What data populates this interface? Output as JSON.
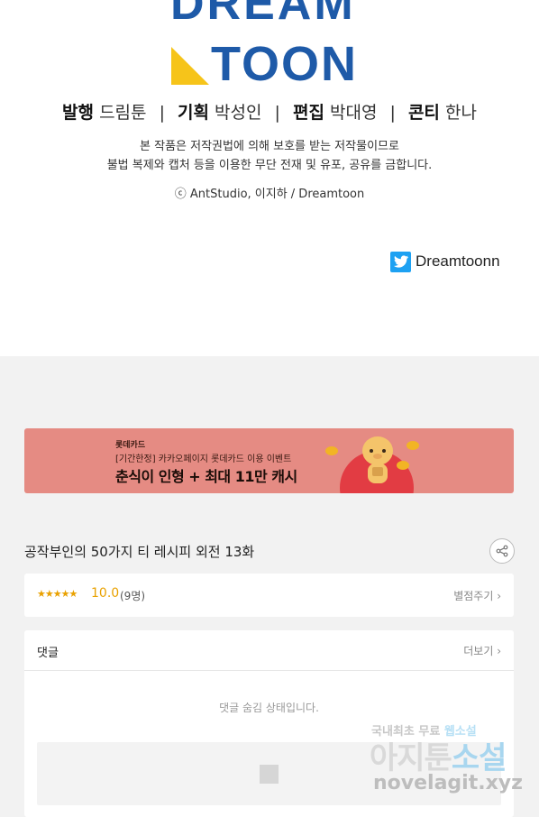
{
  "logo": {
    "line1": "DREAM",
    "line2": "TOON",
    "brand_blue": "#1E5AA8",
    "brand_yellow": "#F6C41A"
  },
  "staff": [
    {
      "role": "발행",
      "name": "드림툰"
    },
    {
      "role": "기획",
      "name": "박성인"
    },
    {
      "role": "편집",
      "name": "박대영"
    },
    {
      "role": "콘티",
      "name": "한나"
    }
  ],
  "staff_separator": "|",
  "notice": {
    "line1": "본 작품은 저작권법에 의해 보호를 받는 저작물이므로",
    "line2": "불법 복제와 캡처 등을 이용한 무단 전재 및 유포, 공유를 금합니다."
  },
  "copyright": "ⓒ AntStudio, 이지하 / Dreamtoon",
  "twitter": {
    "icon": "twitter-bird-icon",
    "handle": "Dreamtoonn"
  },
  "banner": {
    "brand": "롯데카드",
    "event": "[기간한정] 카카오페이지 롯데카드 이용 이벤트",
    "headline": "춘식이 인형 + 최대 11만 캐시",
    "background": "#E58B83"
  },
  "episode": {
    "title": "공작부인의 50가지 티 레시피 외전 13화",
    "share_icon": "share-icon"
  },
  "rating": {
    "stars": "★★★★★",
    "score": "10.0",
    "count": "(9명)",
    "rate_link": "별점주기 ›"
  },
  "comments": {
    "title": "댓글",
    "more": "더보기 ›",
    "hidden_message": "댓글 숨김 상태입니다."
  },
  "watermark": {
    "top_plain": "국내최초 무료 ",
    "top_highlight": "웹소설",
    "mid_plain": "아지툰",
    "mid_highlight": "소설",
    "bottom": "novelagit.xyz"
  }
}
